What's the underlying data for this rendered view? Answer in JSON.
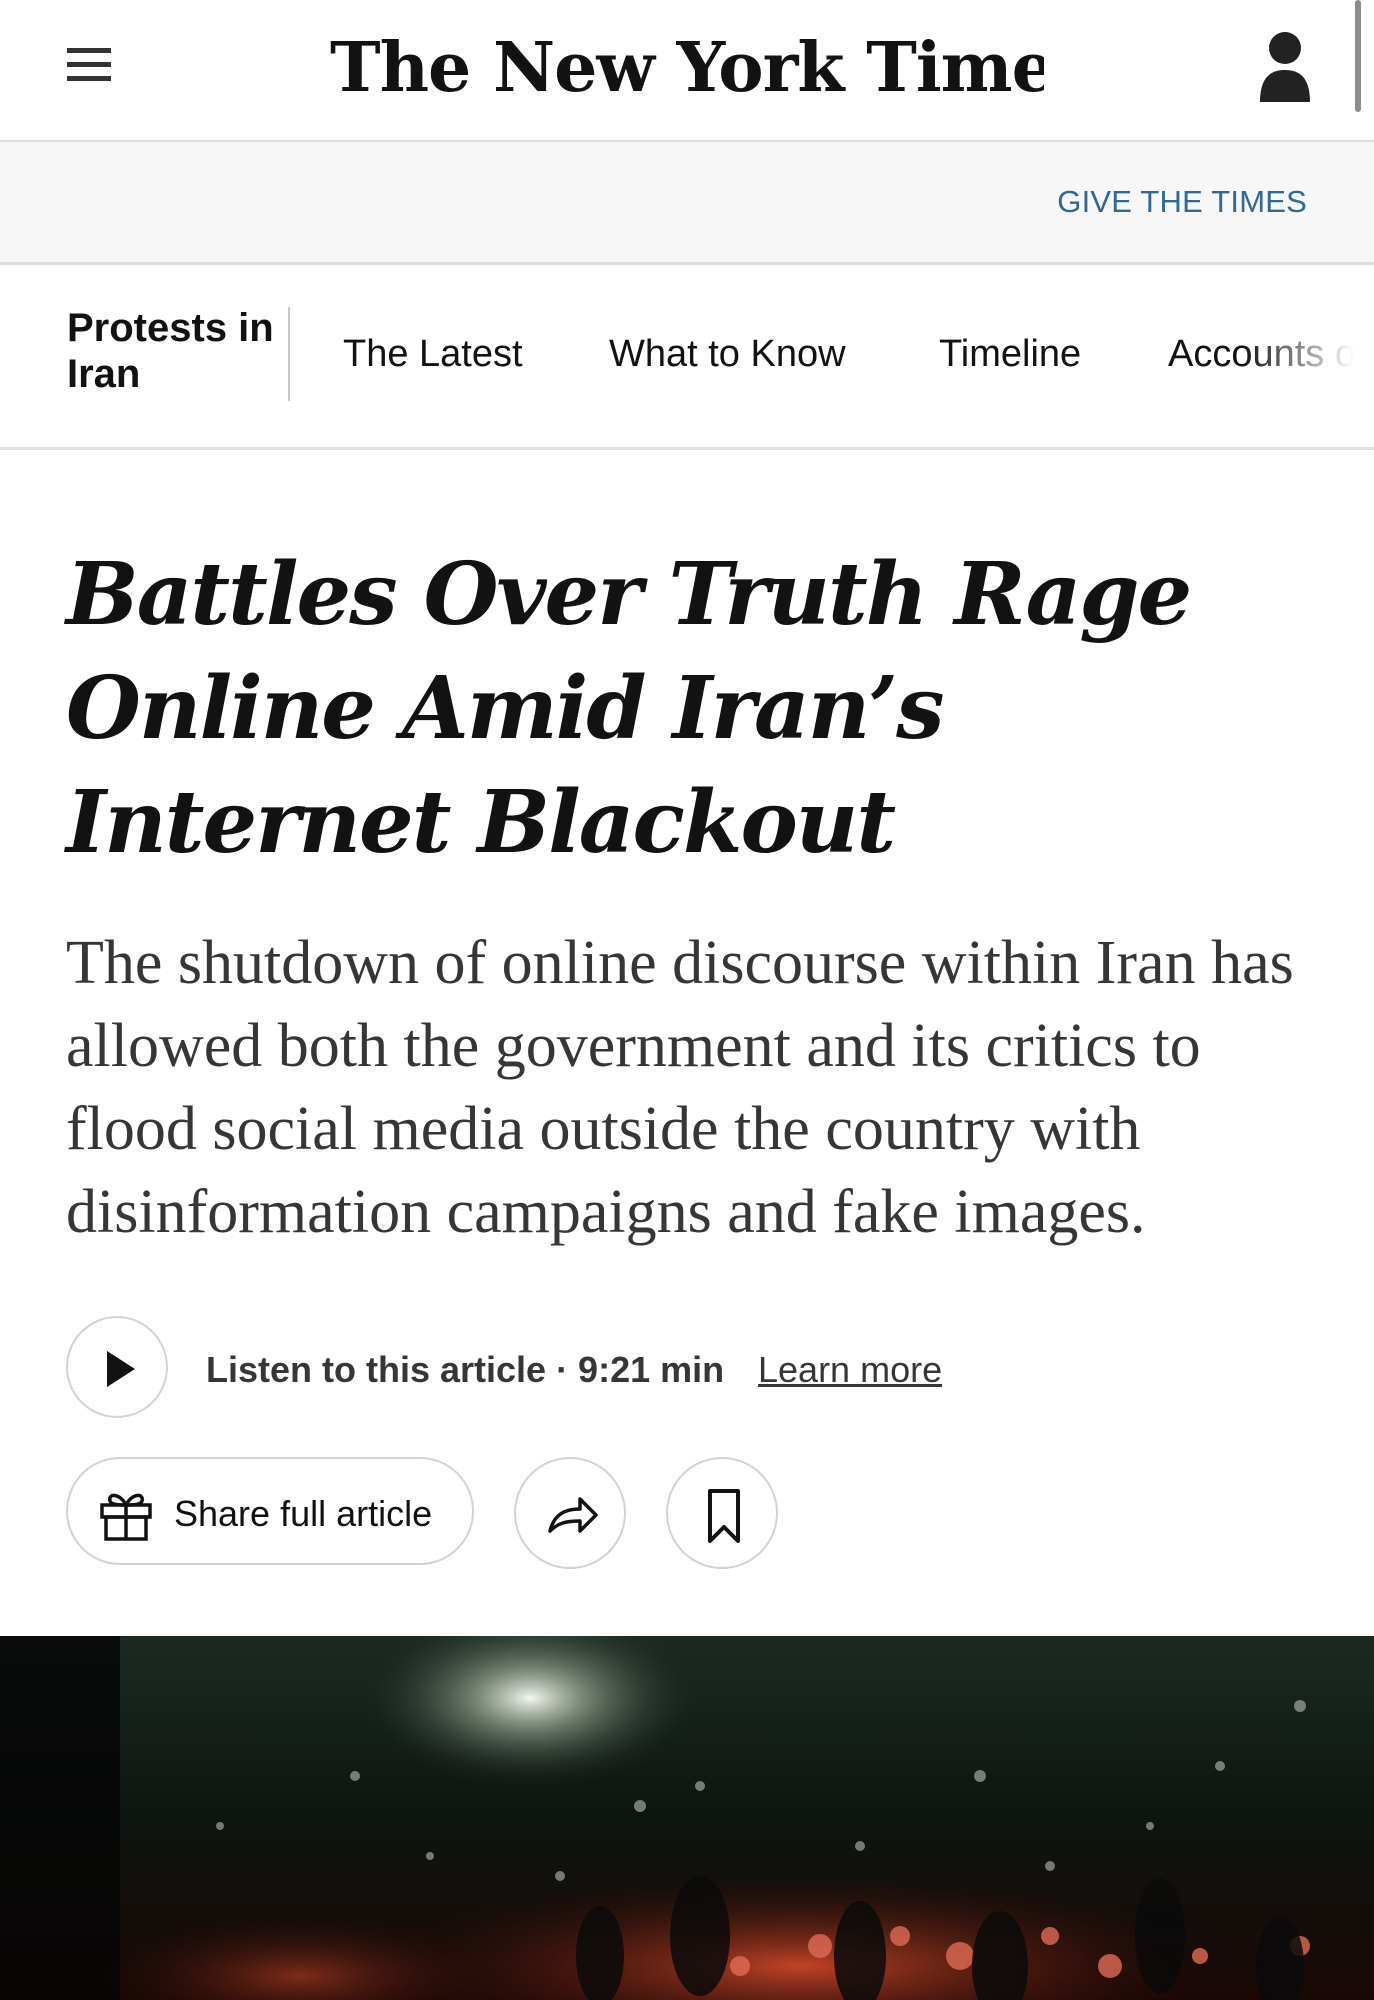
{
  "masthead": {
    "logo_text": "The New York Times",
    "menu_icon": "hamburger-menu-icon",
    "account_icon": "user-account-icon"
  },
  "give_bar": {
    "link_label": "GIVE THE TIMES"
  },
  "section_nav": {
    "section_label": "Protests in Iran",
    "tabs": [
      {
        "label": "The Latest"
      },
      {
        "label": "What to Know"
      },
      {
        "label": "Timeline"
      },
      {
        "label": "Accounts o"
      }
    ]
  },
  "article": {
    "headline": "Battles Over Truth Rage Online Amid Iran’s Internet Blackout",
    "summary": "The shutdown of online discourse within Iran has allowed both the government and its critics to flood social media outside the country with disinformation campaigns and fake images."
  },
  "audio": {
    "listen_label": "Listen to this article · 9:21 min",
    "learn_more_label": "Learn more",
    "play_icon": "play-icon"
  },
  "actions": {
    "share_full_label": "Share full article",
    "gift_icon": "gift-icon",
    "share_icon": "share-arrow-icon",
    "bookmark_icon": "bookmark-icon"
  },
  "colors": {
    "link_blue": "#326891",
    "text_dark": "#121212",
    "text_gray": "#363636",
    "border_gray": "#d3d3d3",
    "give_bar_bg": "#f7f7f7"
  }
}
